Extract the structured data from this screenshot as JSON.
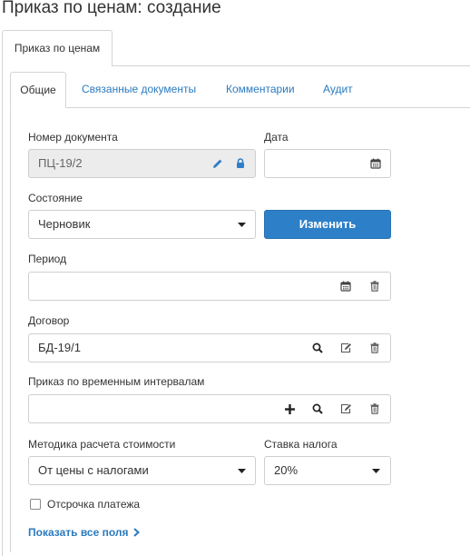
{
  "header": {
    "title": "Приказ по ценам: создание"
  },
  "outer_tab": {
    "label": "Приказ по ценам"
  },
  "tabs": [
    {
      "label": "Общие",
      "active": true
    },
    {
      "label": "Связанные документы"
    },
    {
      "label": "Комментарии"
    },
    {
      "label": "Аудит"
    }
  ],
  "form": {
    "doc_number": {
      "label": "Номер документа",
      "value": "ПЦ-19/2",
      "icons": [
        "pencil-icon",
        "lock-icon"
      ]
    },
    "date": {
      "label": "Дата",
      "value": "",
      "icons": [
        "calendar-icon"
      ]
    },
    "state": {
      "label": "Состояние",
      "value": "Черновик",
      "icons": [
        "caret-down-icon"
      ]
    },
    "change_button": {
      "label": "Изменить"
    },
    "period": {
      "label": "Период",
      "value": "",
      "icons": [
        "calendar-icon",
        "trash-icon"
      ]
    },
    "contract": {
      "label": "Договор",
      "value": "БД-19/1",
      "icons": [
        "search-icon",
        "edit-icon",
        "trash-icon"
      ]
    },
    "time_interval_order": {
      "label": "Приказ по временным интервалам",
      "value": "",
      "icons": [
        "plus-icon",
        "search-icon",
        "edit-icon",
        "trash-icon"
      ]
    },
    "cost_method": {
      "label": "Методика расчета стоимости",
      "value": "От цены с налогами",
      "icons": [
        "caret-down-icon"
      ]
    },
    "tax_rate": {
      "label": "Ставка налога",
      "value": "20%",
      "icons": [
        "caret-down-icon"
      ]
    },
    "payment_deferral": {
      "label": "Отсрочка платежа",
      "checked": false
    }
  },
  "show_all_fields": {
    "label": "Показать все поля"
  },
  "colors": {
    "accent": "#2d7fc8",
    "link": "#2a7abf",
    "border": "#d4d4d4",
    "readonly_bg": "#ececec",
    "text": "#333333"
  }
}
